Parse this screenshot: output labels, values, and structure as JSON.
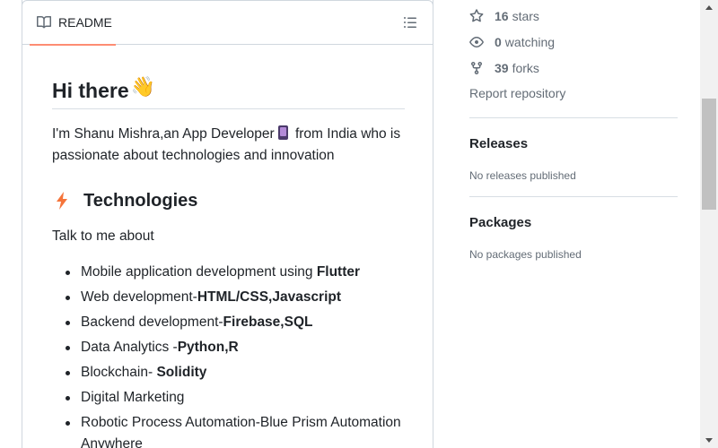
{
  "readme": {
    "tab_label": "README",
    "title": "Hi there",
    "title_emoji": "👋",
    "intro_part1": "I'm Shanu Mishra,an App Developer",
    "intro_part2": "from India who is passionate about technologies and innovation",
    "section_title": "Technologies",
    "talk_label": "Talk to me about",
    "items": [
      {
        "text": "Mobile application development using ",
        "bold": "Flutter"
      },
      {
        "text": "Web development-",
        "bold": "HTML/CSS,Javascript"
      },
      {
        "text": "Backend development-",
        "bold": "Firebase,SQL"
      },
      {
        "text": "Data Analytics -",
        "bold": "Python,R"
      },
      {
        "text": "Blockchain- ",
        "bold": "Solidity"
      },
      {
        "text": "Digital Marketing",
        "bold": ""
      },
      {
        "text": "Robotic Process Automation-Blue Prism Automation Anywhere",
        "bold": ""
      }
    ]
  },
  "sidebar": {
    "stars_count": "16",
    "stars_label": "stars",
    "watching_count": "0",
    "watching_label": "watching",
    "forks_count": "39",
    "forks_label": "forks",
    "report_label": "Report repository",
    "releases_title": "Releases",
    "releases_note": "No releases published",
    "packages_title": "Packages",
    "packages_note": "No packages published"
  },
  "colors": {
    "tab_underline": "#fd8c73",
    "muted_text": "#636c76",
    "border": "#d0d7de",
    "bolt": "#f5743a"
  },
  "icons": {
    "tab": "book-icon",
    "outline": "list-icon",
    "stars": "star-icon",
    "watching": "eye-icon",
    "forks": "repo-forked-icon",
    "section": "high-voltage-icon"
  }
}
